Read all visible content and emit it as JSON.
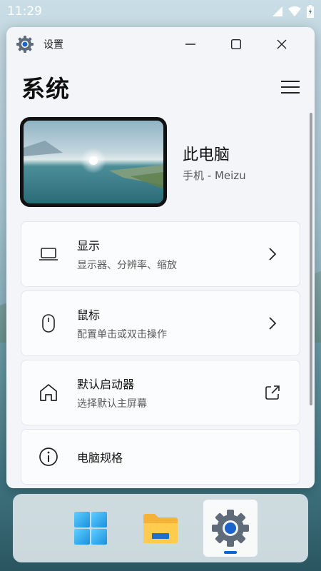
{
  "statusbar": {
    "time": "11:29"
  },
  "window": {
    "app_title": "设置",
    "page_title": "系统"
  },
  "device": {
    "name": "此电脑",
    "subtitle": "手机 - Meizu"
  },
  "cards": [
    {
      "title": "显示",
      "subtitle": "显示器、分辨率、缩放",
      "icon": "laptop-icon",
      "trail": "chevron-right-icon"
    },
    {
      "title": "鼠标",
      "subtitle": "配置单击或双击操作",
      "icon": "mouse-icon",
      "trail": "chevron-right-icon"
    },
    {
      "title": "默认启动器",
      "subtitle": "选择默认主屏幕",
      "icon": "home-icon",
      "trail": "open-external-icon"
    },
    {
      "title": "电脑规格",
      "subtitle": "",
      "icon": "info-icon",
      "trail": ""
    }
  ],
  "taskbar": {
    "items": [
      "start-icon",
      "file-explorer-icon",
      "settings-icon"
    ],
    "active": "settings-icon"
  },
  "colors": {
    "accent": "#0a66d6"
  }
}
